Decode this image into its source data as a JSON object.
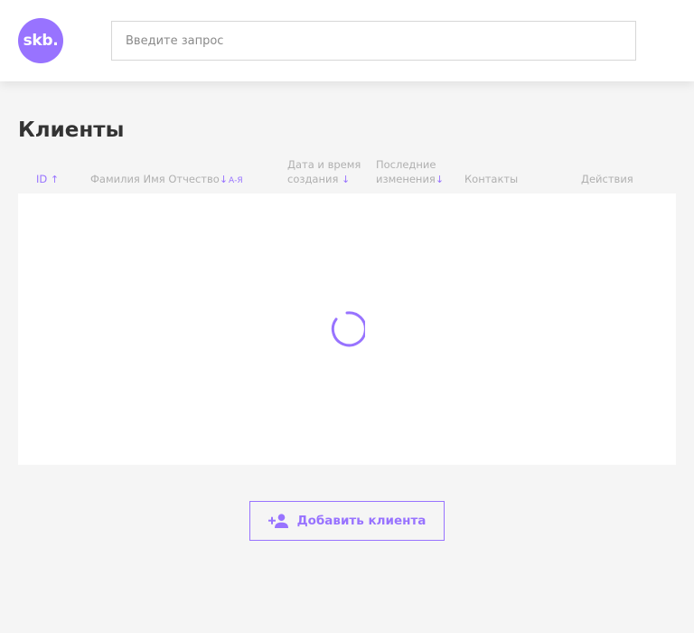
{
  "header": {
    "logo_text": "skb.",
    "search_placeholder": "Введите запрос"
  },
  "page": {
    "title": "Клиенты"
  },
  "table": {
    "columns": {
      "id": {
        "label": "ID",
        "sort_arrow": "↑"
      },
      "fio": {
        "label": "Фамилия Имя Отчество",
        "sort_arrow": "↓",
        "sort_hint": "А-Я"
      },
      "created": {
        "line1": "Дата и время",
        "line2": "создания",
        "sort_arrow": "↓"
      },
      "updated": {
        "line1": "Последние",
        "line2": "изменения",
        "sort_arrow": "↓"
      },
      "contacts": {
        "label": "Контакты"
      },
      "actions": {
        "label": "Действия"
      }
    },
    "loading": true
  },
  "add_button": {
    "label": "Добавить клиента",
    "icon": "add-user-icon"
  },
  "colors": {
    "accent": "#9873ff",
    "background": "#f5f5f5",
    "text": "#333333",
    "muted": "#b0b0b0"
  }
}
